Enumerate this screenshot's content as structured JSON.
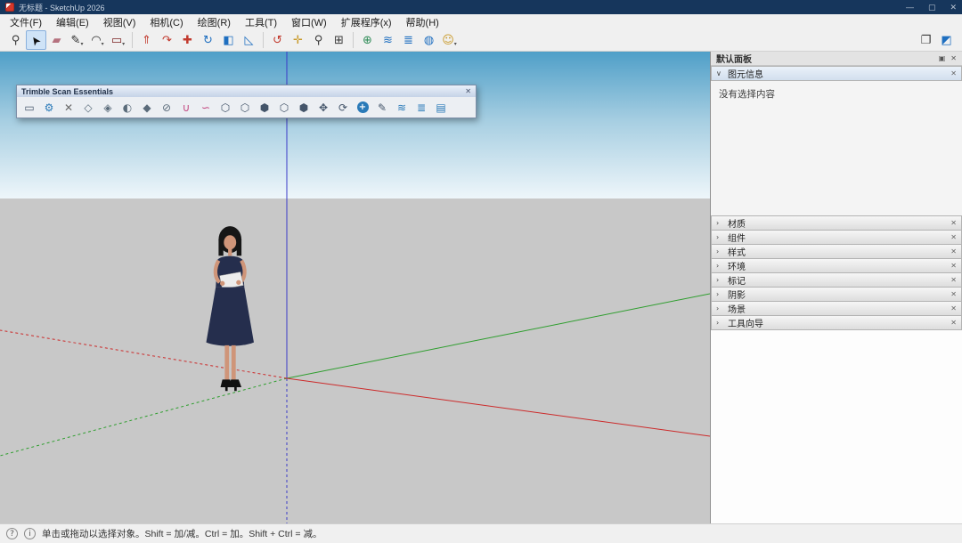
{
  "titlebar": {
    "title": "无标题 - SketchUp 2026",
    "minimize_glyph": "—",
    "maximize_glyph": "▢",
    "close_glyph": "✕"
  },
  "menubar": {
    "items": [
      {
        "name": "menu-file",
        "label": "文件(F)"
      },
      {
        "name": "menu-edit",
        "label": "编辑(E)"
      },
      {
        "name": "menu-view",
        "label": "视图(V)"
      },
      {
        "name": "menu-camera",
        "label": "相机(C)"
      },
      {
        "name": "menu-draw",
        "label": "绘图(R)"
      },
      {
        "name": "menu-tools",
        "label": "工具(T)"
      },
      {
        "name": "menu-window",
        "label": "窗口(W)"
      },
      {
        "name": "menu-extensions",
        "label": "扩展程序(x)"
      },
      {
        "name": "menu-help",
        "label": "帮助(H)"
      }
    ]
  },
  "toolbar": {
    "main": [
      {
        "name": "search-icon",
        "glyph": "⚲",
        "color": "#3a3a3a"
      },
      {
        "name": "select-tool-icon",
        "glyph": "➤",
        "color": "#111111",
        "active": true,
        "rot": -125
      },
      {
        "name": "eraser-tool-icon",
        "glyph": "▰",
        "color": "#b5717e"
      },
      {
        "name": "line-tool-icon",
        "glyph": "✎",
        "color": "#2a2a2a",
        "dropdown": true
      },
      {
        "name": "arc-tool-icon",
        "glyph": "◠",
        "color": "#2a2a2a",
        "dropdown": true
      },
      {
        "name": "rectangle-tool-icon",
        "glyph": "▭",
        "color": "#7a2020",
        "dropdown": true
      },
      {
        "name": "pushpull-tool-icon",
        "glyph": "⇑",
        "color": "#c23a2e",
        "sep": true
      },
      {
        "name": "followme-tool-icon",
        "glyph": "↷",
        "color": "#c23a2e"
      },
      {
        "name": "move-tool-icon",
        "glyph": "✚",
        "color": "#c23a2e"
      },
      {
        "name": "rotate-tool-icon",
        "glyph": "↻",
        "color": "#1f6fc0"
      },
      {
        "name": "paint-bucket-icon",
        "glyph": "◧",
        "color": "#1f6fc0"
      },
      {
        "name": "axes-tool-icon",
        "glyph": "◺",
        "color": "#1f6fc0"
      },
      {
        "name": "orbit-tool-icon",
        "glyph": "↺",
        "color": "#c23a2e",
        "sep": true
      },
      {
        "name": "pan-tool-icon",
        "glyph": "✛",
        "color": "#c99a2a"
      },
      {
        "name": "zoom-tool-icon",
        "glyph": "⚲",
        "color": "#3a3a3a"
      },
      {
        "name": "zoom-extents-icon",
        "glyph": "⊞",
        "color": "#3a3a3a"
      },
      {
        "name": "add-location-icon",
        "glyph": "⊕",
        "color": "#2e8b57",
        "sep": true
      },
      {
        "name": "warehouse-icon",
        "glyph": "≋",
        "color": "#1f6fc0"
      },
      {
        "name": "extension-warehouse-icon",
        "glyph": "≣",
        "color": "#1f6fc0"
      },
      {
        "name": "trimble-connect-icon",
        "glyph": "◍",
        "color": "#1f6fc0"
      },
      {
        "name": "help-menu-icon",
        "glyph": "☺",
        "color": "#c99a2a",
        "dropdown": true
      }
    ],
    "right": [
      {
        "name": "document-panel-icon",
        "glyph": "❐",
        "color": "#3a3a3a"
      },
      {
        "name": "model-cube-icon",
        "glyph": "◩",
        "color": "#1f6fc0"
      }
    ]
  },
  "scan_toolbar": {
    "title": "Trimble Scan Essentials",
    "close_glyph": "✕",
    "icons": [
      {
        "name": "scan-window-icon",
        "glyph": "▭",
        "color": "#44556a"
      },
      {
        "name": "scan-settings-icon",
        "glyph": "⚙",
        "color": "#2a7ab8"
      },
      {
        "name": "scan-clear-icon",
        "glyph": "✕",
        "color": "#6a6a6a"
      },
      {
        "name": "pointcloud-light-icon",
        "glyph": "◇",
        "color": "#5a6b7a"
      },
      {
        "name": "pointcloud-quarter-icon",
        "glyph": "◈",
        "color": "#5a6b7a"
      },
      {
        "name": "pointcloud-half-icon",
        "glyph": "◐",
        "color": "#5a6b7a"
      },
      {
        "name": "pointcloud-full-icon",
        "glyph": "◆",
        "color": "#5a6b7a"
      },
      {
        "name": "pointcloud-off-icon",
        "glyph": "⊘",
        "color": "#5a6b7a"
      },
      {
        "name": "magnet-select-icon",
        "glyph": "∪",
        "color": "#c2447e"
      },
      {
        "name": "lasso-select-icon",
        "glyph": "∽",
        "color": "#c2447e"
      },
      {
        "name": "hexagon-cloud-icon",
        "glyph": "⬡",
        "color": "#44556a"
      },
      {
        "name": "hexagon-region-icon",
        "glyph": "⬡",
        "color": "#44556a"
      },
      {
        "name": "hexagon-box-icon",
        "glyph": "⬢",
        "color": "#44556a"
      },
      {
        "name": "hexagon-clip-icon",
        "glyph": "⬡",
        "color": "#44556a"
      },
      {
        "name": "hexagon-edit-icon",
        "glyph": "⬢",
        "color": "#44556a"
      },
      {
        "name": "points-move-icon",
        "glyph": "✥",
        "color": "#44556a"
      },
      {
        "name": "points-rotate-icon",
        "glyph": "⟳",
        "color": "#44556a"
      },
      {
        "name": "add-point-icon",
        "glyph": "+",
        "color": "#2a7ab8",
        "circle": true
      },
      {
        "name": "draw-edge-icon",
        "glyph": "✎",
        "color": "#44556a"
      },
      {
        "name": "cloud-compare-icon",
        "glyph": "≋",
        "color": "#2a7ab8"
      },
      {
        "name": "cloud-layers-icon",
        "glyph": "≣",
        "color": "#2a7ab8"
      },
      {
        "name": "cloud-stack-icon",
        "glyph": "▤",
        "color": "#2a7ab8"
      }
    ]
  },
  "viewport": {
    "colors": {
      "sky_top": "#4f9fc8",
      "sky_mid": "#a8cfe2",
      "sky_low": "#eef6fa",
      "ground": "#c8c8c8",
      "axis_red": "#cc2a2a",
      "axis_green": "#2e9e2e",
      "axis_blue": "#3a3ac8"
    },
    "figure": {
      "hair": "#161616",
      "skin": "#cf9579",
      "dress": "#252e4d",
      "item": "#ececec",
      "shoes": "#101010"
    }
  },
  "right_panel": {
    "title": "默认面板",
    "panel_menu_glyph": "▣",
    "panel_close_glyph": "✕",
    "chevron_expanded": "∨",
    "chevron_collapsed": "›",
    "close_glyph": "✕",
    "entity_info": {
      "label": "图元信息",
      "empty_text": "没有选择内容"
    },
    "sections": [
      {
        "name": "materials",
        "label": "材质"
      },
      {
        "name": "components",
        "label": "组件"
      },
      {
        "name": "styles",
        "label": "样式"
      },
      {
        "name": "environments",
        "label": "环境"
      },
      {
        "name": "tags",
        "label": "标记"
      },
      {
        "name": "shadows",
        "label": "阴影"
      },
      {
        "name": "scenes",
        "label": "场景"
      },
      {
        "name": "instructor",
        "label": "工具向导"
      }
    ]
  },
  "statusbar": {
    "help_glyph": "?",
    "info_glyph": "i",
    "hint": "单击或拖动以选择对象。Shift = 加/减。Ctrl = 加。Shift + Ctrl = 减。"
  }
}
